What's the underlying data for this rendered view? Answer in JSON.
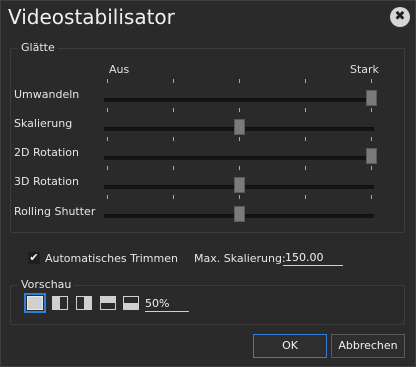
{
  "window": {
    "title": "Videostabilisator",
    "close_glyph": "✖"
  },
  "smoothness": {
    "group_label": "Glätte",
    "scale_min": "Aus",
    "scale_max": "Stark",
    "rows": [
      {
        "label": "Umwandeln",
        "value": 1.0
      },
      {
        "label": "Skalierung",
        "value": 0.5
      },
      {
        "label": "2D Rotation",
        "value": 1.0
      },
      {
        "label": "3D Rotation",
        "value": 0.5
      },
      {
        "label": "Rolling Shutter",
        "value": 0.5
      }
    ]
  },
  "auto_trim": {
    "label": "Automatisches Trimmen",
    "checked": true,
    "check_glyph": "✔"
  },
  "max_scaling": {
    "label": "Max. Skalierung:",
    "value": "150.00"
  },
  "preview": {
    "group_label": "Vorschau",
    "modes": [
      {
        "icon": "single-view-icon",
        "selected": true
      },
      {
        "icon": "split-vertical-left-icon",
        "selected": false
      },
      {
        "icon": "split-vertical-right-icon",
        "selected": false
      },
      {
        "icon": "split-horizontal-top-icon",
        "selected": false
      },
      {
        "icon": "split-horizontal-bottom-icon",
        "selected": false
      }
    ],
    "zoom": "50%"
  },
  "buttons": {
    "ok": "OK",
    "cancel": "Abbrechen"
  },
  "colors": {
    "accent": "#2f7fd8",
    "background": "#2a2a2a"
  }
}
